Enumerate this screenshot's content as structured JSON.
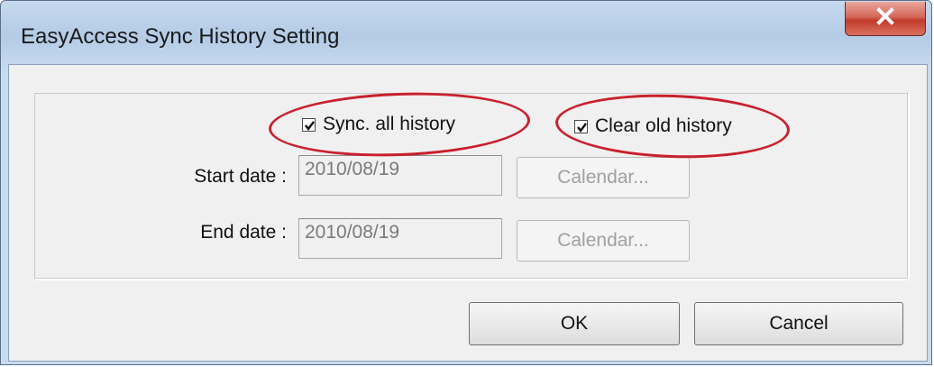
{
  "window": {
    "title": "EasyAccess Sync History Setting",
    "close_glyph": "x"
  },
  "options": {
    "sync_all": {
      "label": "Sync. all history",
      "checked": true
    },
    "clear_old": {
      "label": "Clear old history",
      "checked": true
    }
  },
  "fields": {
    "start_date": {
      "label": "Start date :",
      "value": "2010/08/19",
      "button": "Calendar..."
    },
    "end_date": {
      "label": "End date :",
      "value": "2010/08/19",
      "button": "Calendar..."
    }
  },
  "buttons": {
    "ok": "OK",
    "cancel": "Cancel"
  },
  "colors": {
    "annotation": "#c8202c",
    "close_button": "#c9463a"
  }
}
